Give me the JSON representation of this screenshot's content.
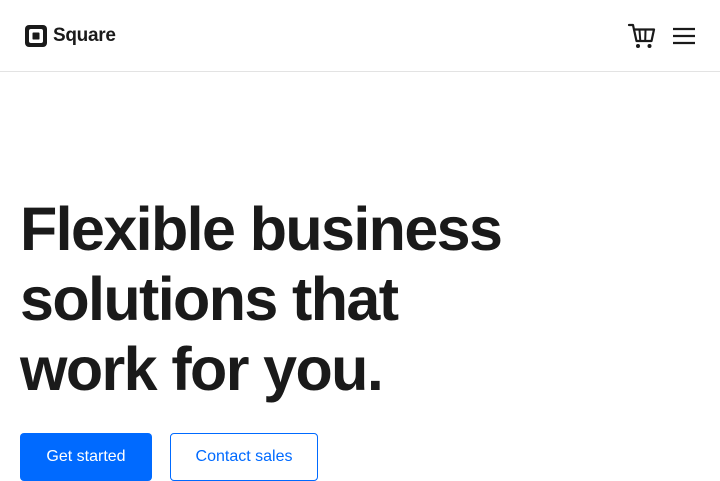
{
  "header": {
    "logo_text": "Square",
    "logo_icon": "square-logo-icon",
    "cart_icon": "cart-icon",
    "menu_icon": "hamburger-menu-icon"
  },
  "hero": {
    "title_lines": [
      "Flexible business",
      "solutions that",
      "work for you."
    ],
    "primary_cta": "Get started",
    "secondary_cta": "Contact sales"
  },
  "colors": {
    "accent": "#006aff",
    "text": "#1a1a1a",
    "background": "#ffffff",
    "divider": "#e3e3e3"
  }
}
